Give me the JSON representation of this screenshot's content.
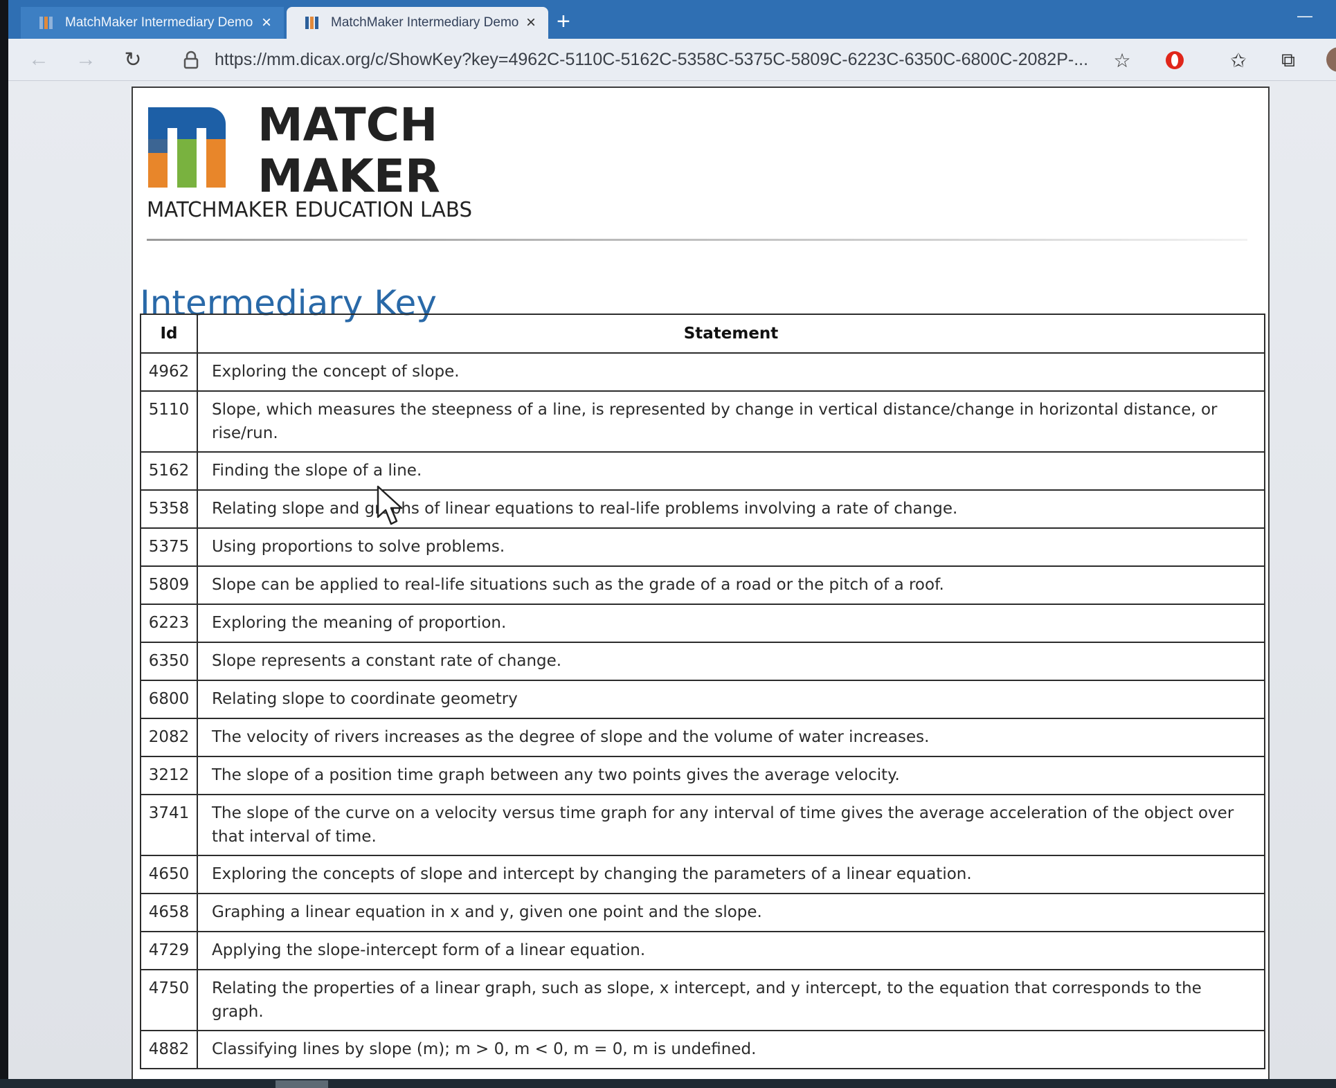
{
  "browser": {
    "tabs": [
      {
        "title": "MatchMaker Intermediary Demo",
        "active": false
      },
      {
        "title": "MatchMaker Intermediary Demo",
        "active": true
      }
    ],
    "url": "https://mm.dicax.org/c/ShowKey?key=4962C-5110C-5162C-5358C-5375C-5809C-6223C-6350C-6800C-2082P-...",
    "accent_color": "#2f6fb3"
  },
  "page": {
    "logo": {
      "word1": "MATCH",
      "word2": "MAKER",
      "tagline": "MATCHMAKER EDUCATION LABS"
    },
    "title": "Intermediary Key",
    "title_color": "#2969a8",
    "table": {
      "headers": {
        "id": "Id",
        "statement": "Statement"
      },
      "rows": [
        {
          "id": "4962",
          "statement": "Exploring the concept of slope."
        },
        {
          "id": "5110",
          "statement": "Slope, which measures the steepness of a line, is represented by change in vertical distance/change in horizontal distance, or rise/run."
        },
        {
          "id": "5162",
          "statement": "Finding the slope of a line."
        },
        {
          "id": "5358",
          "statement": "Relating slope and graphs of linear equations to real-life problems involving a rate of change."
        },
        {
          "id": "5375",
          "statement": "Using proportions to solve problems."
        },
        {
          "id": "5809",
          "statement": "Slope can be applied to real-life situations such as the grade of a road or the pitch of a roof."
        },
        {
          "id": "6223",
          "statement": "Exploring the meaning of proportion."
        },
        {
          "id": "6350",
          "statement": "Slope represents a constant rate of change."
        },
        {
          "id": "6800",
          "statement": "Relating slope to coordinate geometry"
        },
        {
          "id": "2082",
          "statement": "The velocity of rivers increases as the degree of slope and the volume of water increases."
        },
        {
          "id": "3212",
          "statement": "The slope of a position time graph between any two points gives the average velocity."
        },
        {
          "id": "3741",
          "statement": "The slope of the curve on a velocity versus time graph for any interval of time gives the average acceleration of the object over that interval of time."
        },
        {
          "id": "4650",
          "statement": "Exploring the concepts of slope and intercept by changing the parameters of a linear equation."
        },
        {
          "id": "4658",
          "statement": "Graphing a linear equation in x and y, given one point and the slope."
        },
        {
          "id": "4729",
          "statement": "Applying the slope-intercept form of a linear equation."
        },
        {
          "id": "4750",
          "statement": "Relating the properties of a linear graph, such as slope, x intercept, and y intercept, to the equation that corresponds to the graph."
        },
        {
          "id": "4882",
          "statement": "Classifying lines by slope (m); m > 0, m < 0, m = 0, m is undefined."
        }
      ]
    }
  }
}
